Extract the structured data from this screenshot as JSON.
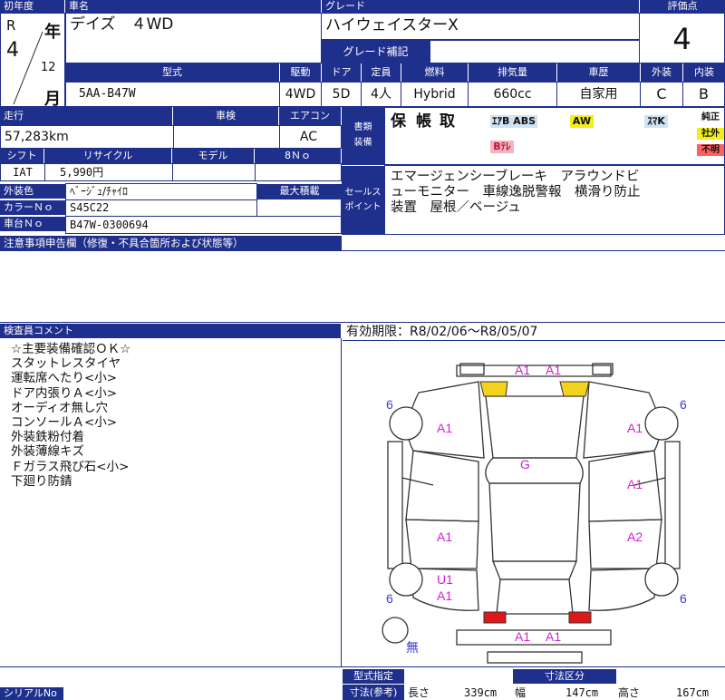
{
  "labels": {
    "year": "初年度",
    "car_name": "車名",
    "grade": "グレード",
    "score": "評価点",
    "grade_confirm": "グレード補記",
    "model_code": "型式",
    "drive": "駆動",
    "door": "ドア",
    "capacity": "定員",
    "fuel": "燃料",
    "displacement": "排気量",
    "usage": "車歴",
    "exterior": "外装",
    "interior": "内装",
    "mileage": "走行",
    "inspection": "車検",
    "aircon": "エアコン",
    "documents": "書類\n装備",
    "shift": "シフト",
    "recycle": "リサイクル",
    "model": "モデル",
    "eight_no": "8Ｎｏ",
    "color": "外装色",
    "color_no": "カラーＮｏ",
    "chassis_no": "車台Ｎｏ",
    "max_load": "最大積載",
    "sales_point": "セールス\nポイント",
    "notes": "注意事項申告欄（修復・不具合箇所および状態等）",
    "inspector_comment": "検査員コメント",
    "model_spec": "型式指定",
    "dimensions_ref": "寸法(参考)",
    "dimensions": "寸法区分",
    "serial_no": "シリアルNo"
  },
  "vehicle": {
    "era": "R",
    "year": "4",
    "year_suffix": "年",
    "month_num": "12",
    "month_suffix": "月",
    "name": "デイズ　４WD",
    "grade": "ハイウェイスターX",
    "score": "4",
    "model_code": "5AA-B47W",
    "drive": "4WD",
    "door": "5D",
    "capacity": "4人",
    "fuel": "Hybrid",
    "displacement": "660cc",
    "usage": "自家用",
    "exterior_grade": "C",
    "interior_grade": "B",
    "mileage": "57,283km",
    "aircon": "AC",
    "shift": "IAT",
    "recycle": "5,990円",
    "color": "ﾍﾞｰｼﾞｭ/ﾁｬｲﾛ",
    "color_no": "S45C22",
    "chassis_no": "B47W-0300694"
  },
  "documents": {
    "stamps": [
      "保",
      "帳",
      "取"
    ],
    "tags": {
      "abs": "ｴｱB ABS",
      "aw": "AW",
      "sr": "ｽﾏK",
      "btv": "Bﾃﾚ",
      "genuine": "純正",
      "aftermarket": "社外",
      "unknown": "不明"
    },
    "colors": {
      "abs_bg": "#cfe3f2",
      "aw_bg": "#f2ee1a",
      "btv_bg": "#f2b4c4",
      "genuine_bg": "#ffffff",
      "aftermarket_bg": "#f2ee1a",
      "unknown_bg": "#ff6060"
    }
  },
  "sales_point": {
    "lines": [
      "エマージェンシーブレーキ　アラウンドビ",
      "ューモニター　車線逸脱警報　横滑り防止",
      "装置　屋根／ベージュ"
    ]
  },
  "comments": [
    "☆主要装備確認ＯＫ☆",
    "スタットレスタイヤ",
    "運転席へたり<小>",
    "ドア内張りＡ<小>",
    "オーディオ無し穴",
    "コンソールＡ<小>",
    "外装鉄粉付着",
    "外装薄線キズ",
    "Ｆガラス飛び石<小>",
    "下廻り防錆"
  ],
  "inspection": {
    "validity": "有効期限：R8/02/06～R8/05/07"
  },
  "diagram": {
    "marks": {
      "front_bumper_left": "A1",
      "front_bumper_right": "A1",
      "left_front_fender": "A1",
      "right_front_fender": "A1",
      "roof_glass": "G",
      "left_front_door": "A1",
      "right_front_door": "A1",
      "left_rear_door": "A1",
      "right_rear_door": "A2",
      "left_quarter_u": "U1",
      "left_quarter_a": "A1",
      "rear_bumper_left": "A1",
      "rear_bumper_right": "A1",
      "tire_fl": "6",
      "tire_fr": "6",
      "tire_rl": "6",
      "tire_rr": "6",
      "spare": "無"
    },
    "colors": {
      "marks": "#d21fd2",
      "tires": "#3b3bd8",
      "front_lights": "#f2d21a",
      "rear_lights": "#e01818"
    }
  },
  "footer": {
    "length_label": "長さ",
    "length": "339cm",
    "width_label": "幅",
    "width": "147cm",
    "height_label": "高さ",
    "height": "167cm"
  }
}
